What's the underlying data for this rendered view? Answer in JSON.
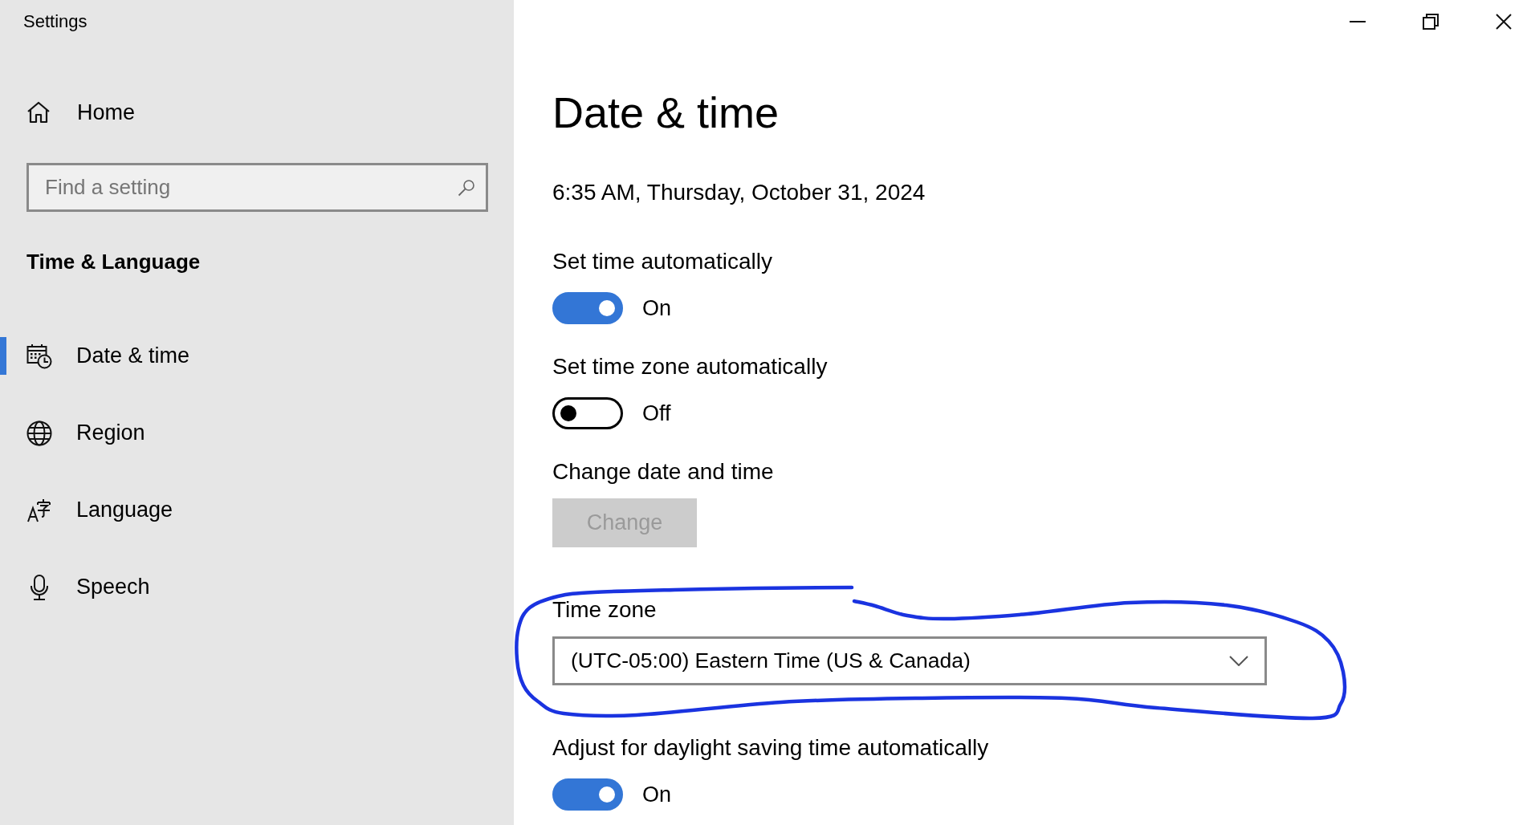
{
  "window": {
    "title": "Settings"
  },
  "sidebar": {
    "home": {
      "label": "Home"
    },
    "search": {
      "placeholder": "Find a setting"
    },
    "section_title": "Time & Language",
    "items": [
      {
        "label": "Date & time",
        "selected": true
      },
      {
        "label": "Region",
        "selected": false
      },
      {
        "label": "Language",
        "selected": false
      },
      {
        "label": "Speech",
        "selected": false
      }
    ]
  },
  "page": {
    "title": "Date & time",
    "current_datetime": "6:35 AM, Thursday, October 31, 2024",
    "settings": [
      {
        "kind": "toggle",
        "label": "Set time automatically",
        "on": true,
        "state_text": "On"
      },
      {
        "kind": "toggle",
        "label": "Set time zone automatically",
        "on": false,
        "state_text": "Off"
      },
      {
        "kind": "button",
        "label": "Change date and time",
        "button": "Change",
        "disabled": true
      },
      {
        "kind": "dropdown",
        "label": "Time zone",
        "value": "(UTC-05:00) Eastern Time (US & Canada)"
      },
      {
        "kind": "toggle",
        "label": "Adjust for daylight saving time automatically",
        "on": true,
        "state_text": "On"
      }
    ]
  }
}
